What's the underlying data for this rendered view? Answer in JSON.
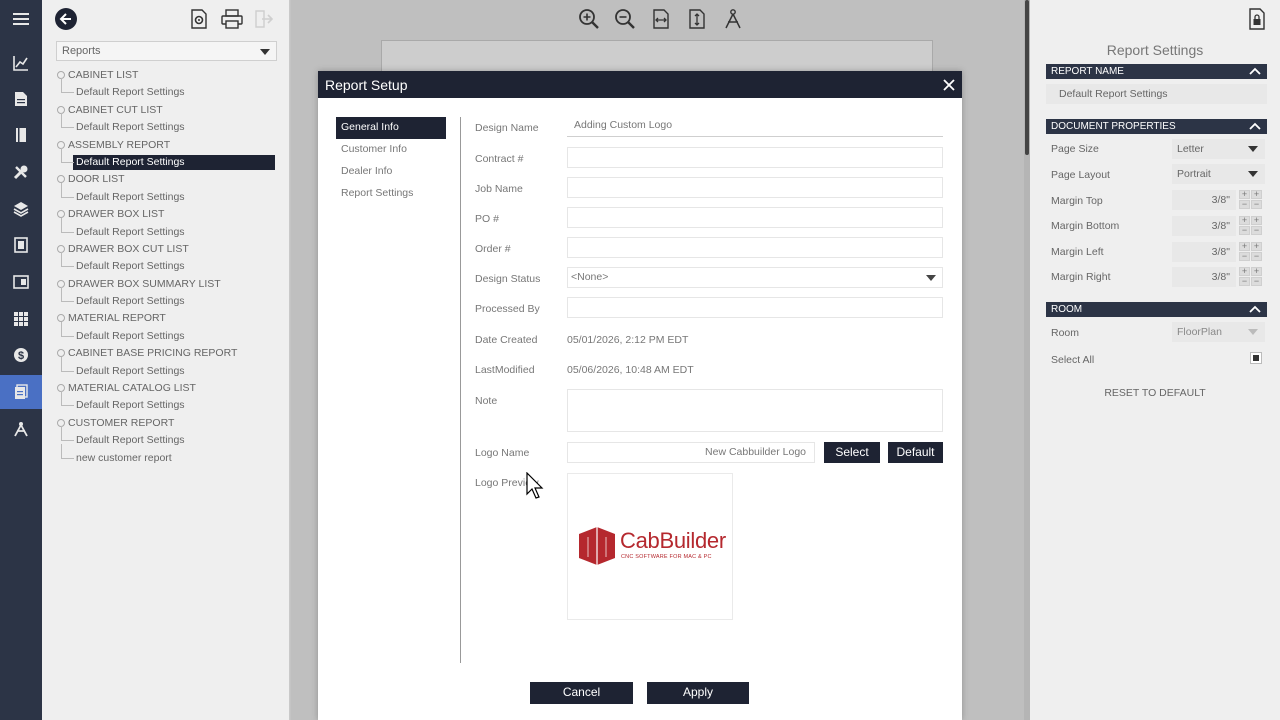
{
  "tree_panel": {
    "reports_select": "Reports",
    "items": [
      {
        "label": "CABINET LIST",
        "children": [
          "Default Report Settings"
        ]
      },
      {
        "label": "CABINET CUT LIST",
        "children": [
          "Default Report Settings"
        ]
      },
      {
        "label": "ASSEMBLY REPORT",
        "children": [
          "Default Report Settings"
        ]
      },
      {
        "label": "DOOR LIST",
        "children": [
          "Default Report Settings"
        ]
      },
      {
        "label": "DRAWER BOX LIST",
        "children": [
          "Default Report Settings"
        ]
      },
      {
        "label": "DRAWER BOX CUT LIST",
        "children": [
          "Default Report Settings"
        ]
      },
      {
        "label": "DRAWER BOX SUMMARY LIST",
        "children": [
          "Default Report Settings"
        ]
      },
      {
        "label": "MATERIAL REPORT",
        "children": [
          "Default Report Settings"
        ]
      },
      {
        "label": "CABINET BASE PRICING REPORT",
        "children": [
          "Default Report Settings"
        ]
      },
      {
        "label": "MATERIAL CATALOG LIST",
        "children": [
          "Default Report Settings"
        ]
      },
      {
        "label": "CUSTOMER REPORT",
        "children": [
          "Default Report Settings",
          "new customer report"
        ]
      }
    ]
  },
  "right_panel": {
    "title": "Report Settings",
    "report_name_header": "REPORT NAME",
    "report_name_value": "Default Report Settings",
    "doc_props_header": "DOCUMENT PROPERTIES",
    "page_size_label": "Page Size",
    "page_size_value": "Letter",
    "page_layout_label": "Page Layout",
    "page_layout_value": "Portrait",
    "margin_top_label": "Margin Top",
    "margin_top_value": "3/8\"",
    "margin_bottom_label": "Margin Bottom",
    "margin_bottom_value": "3/8\"",
    "margin_left_label": "Margin Left",
    "margin_left_value": "3/8\"",
    "margin_right_label": "Margin Right",
    "margin_right_value": "3/8\"",
    "room_header": "ROOM",
    "room_label": "Room",
    "room_value": "FloorPlan",
    "select_all_label": "Select All",
    "reset_label": "RESET TO DEFAULT"
  },
  "modal": {
    "title": "Report Setup",
    "nav": [
      "General Info",
      "Customer Info",
      "Dealer Info",
      "Report Settings"
    ],
    "design_name_label": "Design Name",
    "design_name_value": "Adding Custom Logo",
    "contract_label": "Contract #",
    "contract_value": "",
    "job_name_label": "Job Name",
    "job_name_value": "",
    "po_label": "PO #",
    "po_value": "",
    "order_label": "Order #",
    "order_value": "",
    "design_status_label": "Design Status",
    "design_status_value": "<None>",
    "processed_by_label": "Processed By",
    "processed_by_value": "",
    "date_created_label": "Date Created",
    "date_created_value": "05/01/2026, 2:12 PM EDT",
    "last_modified_label": "LastModified",
    "last_modified_value": "05/06/2026, 10:48 AM EDT",
    "note_label": "Note",
    "note_value": "",
    "logo_name_label": "Logo Name",
    "logo_name_value": "New Cabbuilder Logo",
    "select_button": "Select",
    "default_button": "Default",
    "logo_preview_label": "Logo Preview",
    "logo_brand": "CabBuilder",
    "logo_tagline": "CNC SOFTWARE FOR MAC & PC",
    "cancel_button": "Cancel",
    "apply_button": "Apply"
  },
  "colors": {
    "rail": "#2c3446",
    "dark": "#1e2333",
    "active_rail": "#4a70c4",
    "logo_red": "#b5282e"
  }
}
